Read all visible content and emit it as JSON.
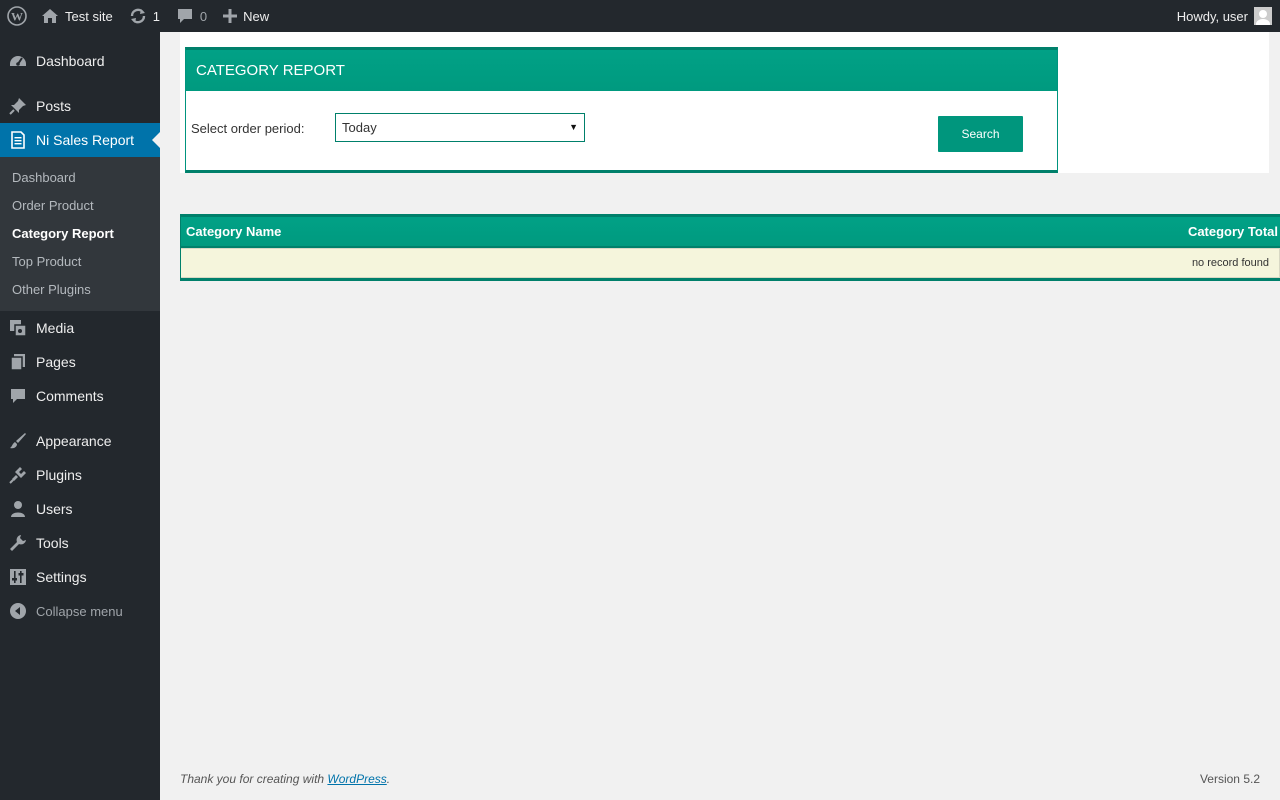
{
  "adminbar": {
    "site_name": "Test site",
    "updates_count": "1",
    "comments_count": "0",
    "new_label": "New",
    "howdy": "Howdy, user"
  },
  "sidebar": {
    "items_top": [
      {
        "label": "Dashboard",
        "icon": "dashboard-icon"
      },
      {
        "label": "Posts",
        "icon": "pin-icon"
      },
      {
        "label": "Ni Sales Report",
        "icon": "document-icon"
      }
    ],
    "submenu": [
      "Dashboard",
      "Order Product",
      "Category Report",
      "Top Product",
      "Other Plugins"
    ],
    "items_bottom": [
      {
        "label": "Media",
        "icon": "media-icon"
      },
      {
        "label": "Pages",
        "icon": "pages-icon"
      },
      {
        "label": "Comments",
        "icon": "comment-icon"
      },
      {
        "label": "Appearance",
        "icon": "brush-icon"
      },
      {
        "label": "Plugins",
        "icon": "plug-icon"
      },
      {
        "label": "Users",
        "icon": "user-icon"
      },
      {
        "label": "Tools",
        "icon": "wrench-icon"
      },
      {
        "label": "Settings",
        "icon": "sliders-icon"
      }
    ],
    "collapse": "Collapse menu"
  },
  "report": {
    "title": "CATEGORY REPORT",
    "period_label": "Select order period:",
    "period_value": "Today",
    "search_button": "Search"
  },
  "table": {
    "headers": [
      "Category Name",
      "Category Total"
    ],
    "empty_text": "no record found"
  },
  "footer": {
    "thanks_prefix": "Thank you for creating with ",
    "link_text": "WordPress",
    "suffix": ".",
    "version": "Version 5.2"
  },
  "colors": {
    "accent_green": "#009a7f",
    "admin_dark": "#23282d",
    "current_blue": "#0073aa",
    "row_beige": "#f5f5dc"
  }
}
